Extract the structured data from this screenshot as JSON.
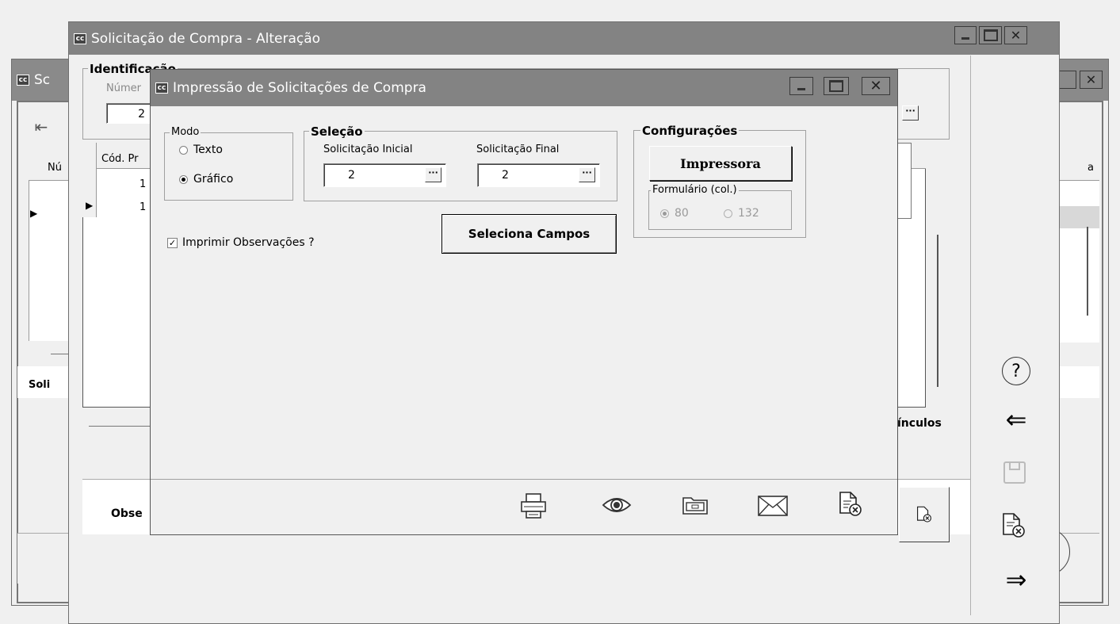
{
  "back_window": {
    "title": "Sc",
    "tab_soli": "Soli",
    "tab_obse": "Obse",
    "grid_col_num": "Nú",
    "grid_col_a": "a"
  },
  "main_window": {
    "title": "Solicitação de Compra - Alteração",
    "identificacao_label": "Identificação",
    "numero_label": "Númer",
    "numero_value": "2",
    "grid_col_cod": "Cód. Pr",
    "grid_rows": [
      "1",
      "1"
    ],
    "vinculos_label": "ínculos",
    "side_icons": [
      "help-icon",
      "back-arrow-icon",
      "save-icon",
      "cancel-document-icon",
      "forward-arrow-icon"
    ]
  },
  "dialog": {
    "title": "Impressão de Solicitações de Compra",
    "modo": {
      "title": "Modo",
      "options": [
        "Texto",
        "Gráfico"
      ],
      "selected": "Gráfico"
    },
    "selecao": {
      "title": "Seleção",
      "inicial_label": "Solicitação Inicial",
      "inicial_value": "2",
      "final_label": "Solicitação Final",
      "final_value": "2",
      "ellipsis": "···"
    },
    "configuracoes": {
      "title": "Configurações",
      "impressora_button": "Impressora",
      "formulario_title": "Formulário (col.)",
      "options": [
        "80",
        "132"
      ],
      "selected": "80"
    },
    "seleciona_campos_button": "Seleciona Campos",
    "imprimir_obs_label": "Imprimir  Observações ?",
    "imprimir_obs_checked": true,
    "toolbar_icons": [
      "printer-icon",
      "preview-eye-icon",
      "folder-icon",
      "email-icon",
      "close-document-icon"
    ]
  },
  "colors": {
    "titlebar": "#838383",
    "window_bg": "#f0f0f0"
  }
}
